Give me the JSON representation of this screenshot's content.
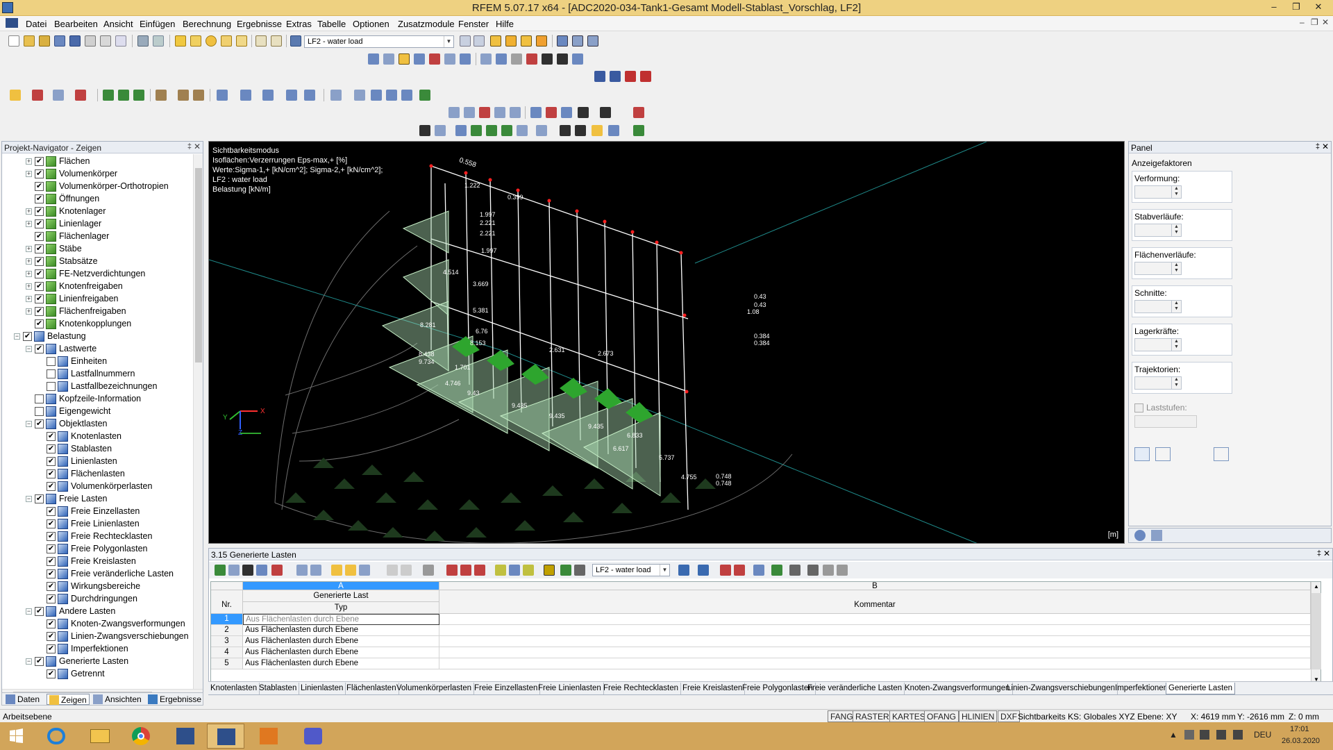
{
  "window": {
    "title": "RFEM 5.07.17 x64 - [ADC2020-034-Tank1-Gesamt Modell-Stablast_Vorschlag, LF2]",
    "controls": {
      "minimize": "–",
      "restore": "❐",
      "close": "✕"
    },
    "doc_controls": {
      "minimize": "–",
      "restore": "❐",
      "close": "✕"
    }
  },
  "menu": [
    "Datei",
    "Bearbeiten",
    "Ansicht",
    "Einfügen",
    "Berechnung",
    "Ergebnisse",
    "Extras",
    "Tabelle",
    "Optionen",
    "Zusatzmodule",
    "Fenster",
    "Hilfe"
  ],
  "toolbar": {
    "loadcase_combo": "LF2 - water load"
  },
  "navigator": {
    "title": "Projekt-Navigator - Zeigen",
    "pin": "‡",
    "close": "✕",
    "items": [
      {
        "label": "Flächen",
        "depth": 1,
        "exp": "+",
        "icon": "green"
      },
      {
        "label": "Volumenkörper",
        "depth": 1,
        "exp": "+",
        "icon": "green"
      },
      {
        "label": "Volumenkörper-Orthotropien",
        "depth": 1,
        "exp": "",
        "icon": "green"
      },
      {
        "label": "Öffnungen",
        "depth": 1,
        "exp": "",
        "icon": "green"
      },
      {
        "label": "Knotenlager",
        "depth": 1,
        "exp": "+",
        "icon": "green"
      },
      {
        "label": "Linienlager",
        "depth": 1,
        "exp": "+",
        "icon": "green"
      },
      {
        "label": "Flächenlager",
        "depth": 1,
        "exp": "",
        "icon": "green"
      },
      {
        "label": "Stäbe",
        "depth": 1,
        "exp": "+",
        "icon": "green"
      },
      {
        "label": "Stabsätze",
        "depth": 1,
        "exp": "+",
        "icon": "green"
      },
      {
        "label": "FE-Netzverdichtungen",
        "depth": 1,
        "exp": "+",
        "icon": "green"
      },
      {
        "label": "Knotenfreigaben",
        "depth": 1,
        "exp": "+",
        "icon": "green"
      },
      {
        "label": "Linienfreigaben",
        "depth": 1,
        "exp": "+",
        "icon": "green"
      },
      {
        "label": "Flächenfreigaben",
        "depth": 1,
        "exp": "+",
        "icon": "green"
      },
      {
        "label": "Knotenkopplungen",
        "depth": 1,
        "exp": "",
        "icon": "green"
      },
      {
        "label": "Belastung",
        "depth": 0,
        "exp": "−",
        "icon": "blue"
      },
      {
        "label": "Lastwerte",
        "depth": 1,
        "exp": "−",
        "icon": "blue"
      },
      {
        "label": "Einheiten",
        "depth": 2,
        "exp": "",
        "icon": "blue",
        "unchecked": true
      },
      {
        "label": "Lastfallnummern",
        "depth": 2,
        "exp": "",
        "icon": "blue",
        "unchecked": true
      },
      {
        "label": "Lastfallbezeichnungen",
        "depth": 2,
        "exp": "",
        "icon": "blue",
        "unchecked": true
      },
      {
        "label": "Kopfzeile-Information",
        "depth": 1,
        "exp": "",
        "icon": "blue",
        "unchecked": true
      },
      {
        "label": "Eigengewicht",
        "depth": 1,
        "exp": "",
        "icon": "blue",
        "unchecked": true
      },
      {
        "label": "Objektlasten",
        "depth": 1,
        "exp": "−",
        "icon": "blue"
      },
      {
        "label": "Knotenlasten",
        "depth": 2,
        "exp": "",
        "icon": "blue"
      },
      {
        "label": "Stablasten",
        "depth": 2,
        "exp": "",
        "icon": "blue"
      },
      {
        "label": "Linienlasten",
        "depth": 2,
        "exp": "",
        "icon": "blue"
      },
      {
        "label": "Flächenlasten",
        "depth": 2,
        "exp": "",
        "icon": "blue"
      },
      {
        "label": "Volumenkörperlasten",
        "depth": 2,
        "exp": "",
        "icon": "blue"
      },
      {
        "label": "Freie Lasten",
        "depth": 1,
        "exp": "−",
        "icon": "blue"
      },
      {
        "label": "Freie Einzellasten",
        "depth": 2,
        "exp": "",
        "icon": "blue"
      },
      {
        "label": "Freie Linienlasten",
        "depth": 2,
        "exp": "",
        "icon": "blue"
      },
      {
        "label": "Freie Rechtecklasten",
        "depth": 2,
        "exp": "",
        "icon": "blue"
      },
      {
        "label": "Freie Polygonlasten",
        "depth": 2,
        "exp": "",
        "icon": "blue"
      },
      {
        "label": "Freie Kreislasten",
        "depth": 2,
        "exp": "",
        "icon": "blue"
      },
      {
        "label": "Freie veränderliche Lasten",
        "depth": 2,
        "exp": "",
        "icon": "blue"
      },
      {
        "label": "Wirkungsbereiche",
        "depth": 2,
        "exp": "",
        "icon": "blue"
      },
      {
        "label": "Durchdringungen",
        "depth": 2,
        "exp": "",
        "icon": "blue"
      },
      {
        "label": "Andere Lasten",
        "depth": 1,
        "exp": "−",
        "icon": "blue"
      },
      {
        "label": "Knoten-Zwangsverformungen",
        "depth": 2,
        "exp": "",
        "icon": "blue"
      },
      {
        "label": "Linien-Zwangsverschiebungen",
        "depth": 2,
        "exp": "",
        "icon": "blue"
      },
      {
        "label": "Imperfektionen",
        "depth": 2,
        "exp": "",
        "icon": "blue"
      },
      {
        "label": "Generierte Lasten",
        "depth": 1,
        "exp": "−",
        "icon": "blue"
      },
      {
        "label": "Getrennt",
        "depth": 2,
        "exp": "",
        "icon": "blue"
      }
    ],
    "tabs": [
      "Daten",
      "Zeigen",
      "Ansichten",
      "Ergebnisse"
    ]
  },
  "view3d": {
    "info_lines": [
      "Sichtbarkeitsmodus",
      "Isoflächen:Verzerrungen Eps-max,+ [%]",
      "Werte:Sigma-1,+ [kN/cm^2]; Sigma-2,+ [kN/cm^2];",
      "LF2 : water load",
      "Belastung [kN/m]"
    ],
    "unit": "[m]",
    "axis_labels": {
      "x": "X",
      "y": "Y",
      "z": "Z"
    },
    "dimension": "0.558",
    "load_labels": [
      "1.222",
      "1.997",
      "2.221",
      "2.221",
      "1.997",
      "4.514",
      "3.669",
      "5.381",
      "8.281",
      "6.76",
      "8.153",
      "8.438",
      "9.734",
      "1.701",
      "4.746",
      "9.43",
      "9.435",
      "9.435",
      "9.435",
      "6.833",
      "6.617",
      "5.737",
      "4.755",
      "0.748",
      "0.748",
      "1.08",
      "0.43",
      "0.43",
      "0.384",
      "0.384",
      "0.399",
      "2.673",
      "2.631"
    ]
  },
  "panel": {
    "title": "Panel",
    "pin": "‡",
    "close": "✕",
    "subtitle": "Anzeigefaktoren",
    "groups": [
      "Verformung:",
      "Stabverläufe:",
      "Flächenverläufe:",
      "Schnitte:",
      "Lagerkräfte:",
      "Trajektorien:"
    ],
    "laststufen": "Laststufen:"
  },
  "table": {
    "title": "3.15 Generierte Lasten",
    "pin": "‡",
    "close": "✕",
    "combo": "LF2 - water load",
    "col_a": "A",
    "col_b": "B",
    "col_nr": "Nr.",
    "col_a_h1": "Generierte Last",
    "col_a_h2": "Typ",
    "col_b_h": "Kommentar",
    "rows": [
      {
        "nr": "1",
        "typ": "Aus Flächenlasten durch Ebene",
        "kommentar": ""
      },
      {
        "nr": "2",
        "typ": "Aus Flächenlasten durch Ebene",
        "kommentar": ""
      },
      {
        "nr": "3",
        "typ": "Aus Flächenlasten durch Ebene",
        "kommentar": ""
      },
      {
        "nr": "4",
        "typ": "Aus Flächenlasten durch Ebene",
        "kommentar": ""
      },
      {
        "nr": "5",
        "typ": "Aus Flächenlasten durch Ebene",
        "kommentar": ""
      }
    ],
    "tabs": [
      "Knotenlasten",
      "Stablasten",
      "Linienlasten",
      "Flächenlasten",
      "Volumenkörperlasten",
      "Freie Einzellasten",
      "Freie Linienlasten",
      "Freie Rechtecklasten",
      "Freie Kreislasten",
      "Freie Polygonlasten",
      "Freie veränderliche Lasten",
      "Knoten-Zwangsverformungen",
      "Linien-Zwangsverschiebungen",
      "Imperfektionen",
      "Generierte Lasten"
    ],
    "active_tab": "Generierte Lasten"
  },
  "status": {
    "left": "Arbeitsebene",
    "toggles": [
      "FANG",
      "RASTER",
      "KARTES",
      "OFANG",
      "HLINIEN",
      "DXF"
    ],
    "info": "Sichtbarkeits KS: Globales XYZ Ebene: XY",
    "x": "X:  4619 mm",
    "y": "Y:  -2616 mm",
    "z": "Z:  0 mm"
  },
  "taskbar": {
    "lang": "DEU",
    "time": "17:01",
    "date": "26.03.2020"
  },
  "colors": {
    "titlebar": "#eed181",
    "taskbar": "#d2a55a",
    "viewport": "#000000",
    "selected_col": "#3399ff"
  }
}
